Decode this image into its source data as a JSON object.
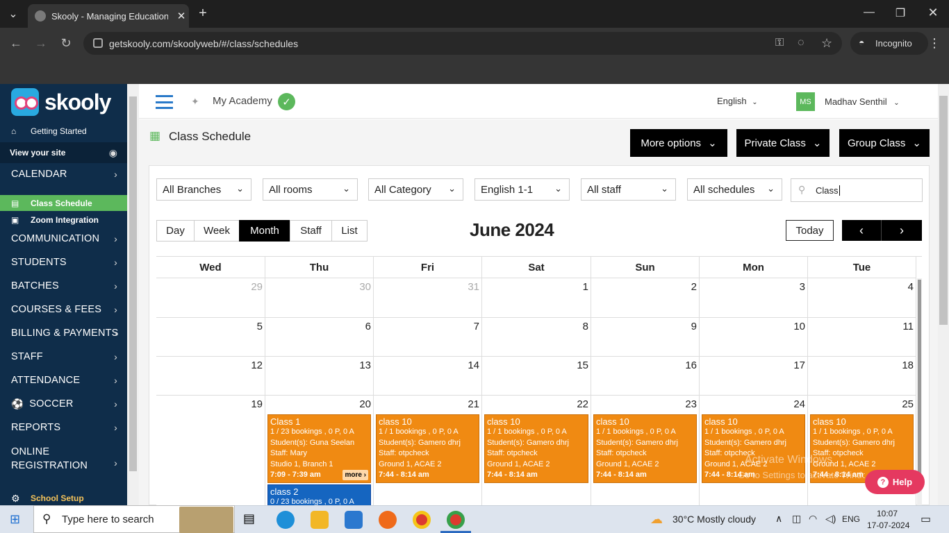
{
  "browser": {
    "tab_title": "Skooly - Managing Educational",
    "url": "getskooly.com/skoolyweb/#/class/schedules",
    "incognito_label": "Incognito"
  },
  "app": {
    "logo_text": "skooly",
    "academy_name": "My Academy",
    "language": "English",
    "user_initials": "MS",
    "user_name": "Madhav Senthil",
    "page_title": "Class Schedule"
  },
  "sidebar": {
    "getting_started": "Getting Started",
    "view_site": "View your site",
    "calendar": "CALENDAR",
    "class_schedule": "Class Schedule",
    "zoom_integration": "Zoom Integration",
    "communication": "COMMUNICATION",
    "students": "STUDENTS",
    "batches": "BATCHES",
    "courses_fees": "COURSES & FEES",
    "billing": "BILLING & PAYMENTS",
    "staff": "STAFF",
    "attendance": "ATTENDANCE",
    "soccer": "SOCCER",
    "reports": "REPORTS",
    "online_registration_1": "ONLINE",
    "online_registration_2": "REGISTRATION",
    "school_setup": "School Setup"
  },
  "actions": {
    "more_options": "More options",
    "private_class": "Private Class",
    "group_class": "Group Class"
  },
  "filters": {
    "branches": "All Branches",
    "rooms": "All rooms",
    "category": "All Category",
    "course": "English 1-1",
    "staff": "All staff",
    "schedules": "All schedules",
    "search_value": "Class"
  },
  "views": {
    "day": "Day",
    "week": "Week",
    "month": "Month",
    "staff": "Staff",
    "list": "List",
    "active": "Month"
  },
  "calendar": {
    "month_title": "June 2024",
    "today_label": "Today",
    "weekdays": [
      "Wed",
      "Thu",
      "Fri",
      "Sat",
      "Sun",
      "Mon",
      "Tue"
    ],
    "weeks": [
      [
        "29",
        "30",
        "31",
        "1",
        "2",
        "3",
        "4"
      ],
      [
        "5",
        "6",
        "7",
        "8",
        "9",
        "10",
        "11"
      ],
      [
        "12",
        "13",
        "14",
        "15",
        "16",
        "17",
        "18"
      ],
      [
        "19",
        "20",
        "21",
        "22",
        "23",
        "24",
        "25"
      ]
    ],
    "events": [
      {
        "title": "Class 1",
        "bookings": "1 / 23 bookings , 0 P, 0 A",
        "students": "Student(s): Guna Seelan",
        "staff": "Staff: Mary",
        "room": "Studio 1, Branch 1",
        "time": "7:09 - 7:39 am",
        "more": "more ›"
      },
      {
        "title": "class 10",
        "bookings": "1 / 1 bookings , 0 P, 0 A",
        "students": "Student(s): Gamero dhrj",
        "staff": "Staff: otpcheck",
        "room": "Ground 1, ACAE 2",
        "time": "7:44 - 8:14 am"
      },
      {
        "title": "class 10",
        "bookings": "1 / 1 bookings , 0 P, 0 A",
        "students": "Student(s): Gamero dhrj",
        "staff": "Staff: otpcheck",
        "room": "Ground 1, ACAE 2",
        "time": "7:44 - 8:14 am"
      },
      {
        "title": "class 10",
        "bookings": "1 / 1 bookings , 0 P, 0 A",
        "students": "Student(s): Gamero dhrj",
        "staff": "Staff: otpcheck",
        "room": "Ground 1, ACAE 2",
        "time": "7:44 - 8:14 am"
      },
      {
        "title": "class 10",
        "bookings": "1 / 1 bookings , 0 P, 0 A",
        "students": "Student(s): Gamero dhrj",
        "staff": "Staff: otpcheck",
        "room": "Ground 1, ACAE 2",
        "time": "7:44 - 8:14 am"
      },
      {
        "title": "class 10",
        "bookings": "1 / 1 bookings , 0 P, 0 A",
        "students": "Student(s): Gamero dhrj",
        "staff": "Staff: otpcheck",
        "room": "Ground 1, ACAE 2",
        "time": "7:44 - 8:14 am"
      }
    ],
    "event2": {
      "title": "class 2",
      "bookings": "0 / 23 bookings , 0 P, 0 A"
    }
  },
  "help_label": "Help",
  "watermark": {
    "line1": "Activate Windows",
    "line2": "Go to Settings to activate Windows."
  },
  "taskbar": {
    "search_placeholder": "Type here to search",
    "weather": "30°C  Mostly cloudy",
    "lang": "ENG",
    "time": "10:07",
    "date": "17-07-2024"
  },
  "colors": {
    "sidebar": "#0f2d4a",
    "active": "#5cb85c",
    "event": "#f08a12",
    "event_blue": "#1565c0"
  }
}
